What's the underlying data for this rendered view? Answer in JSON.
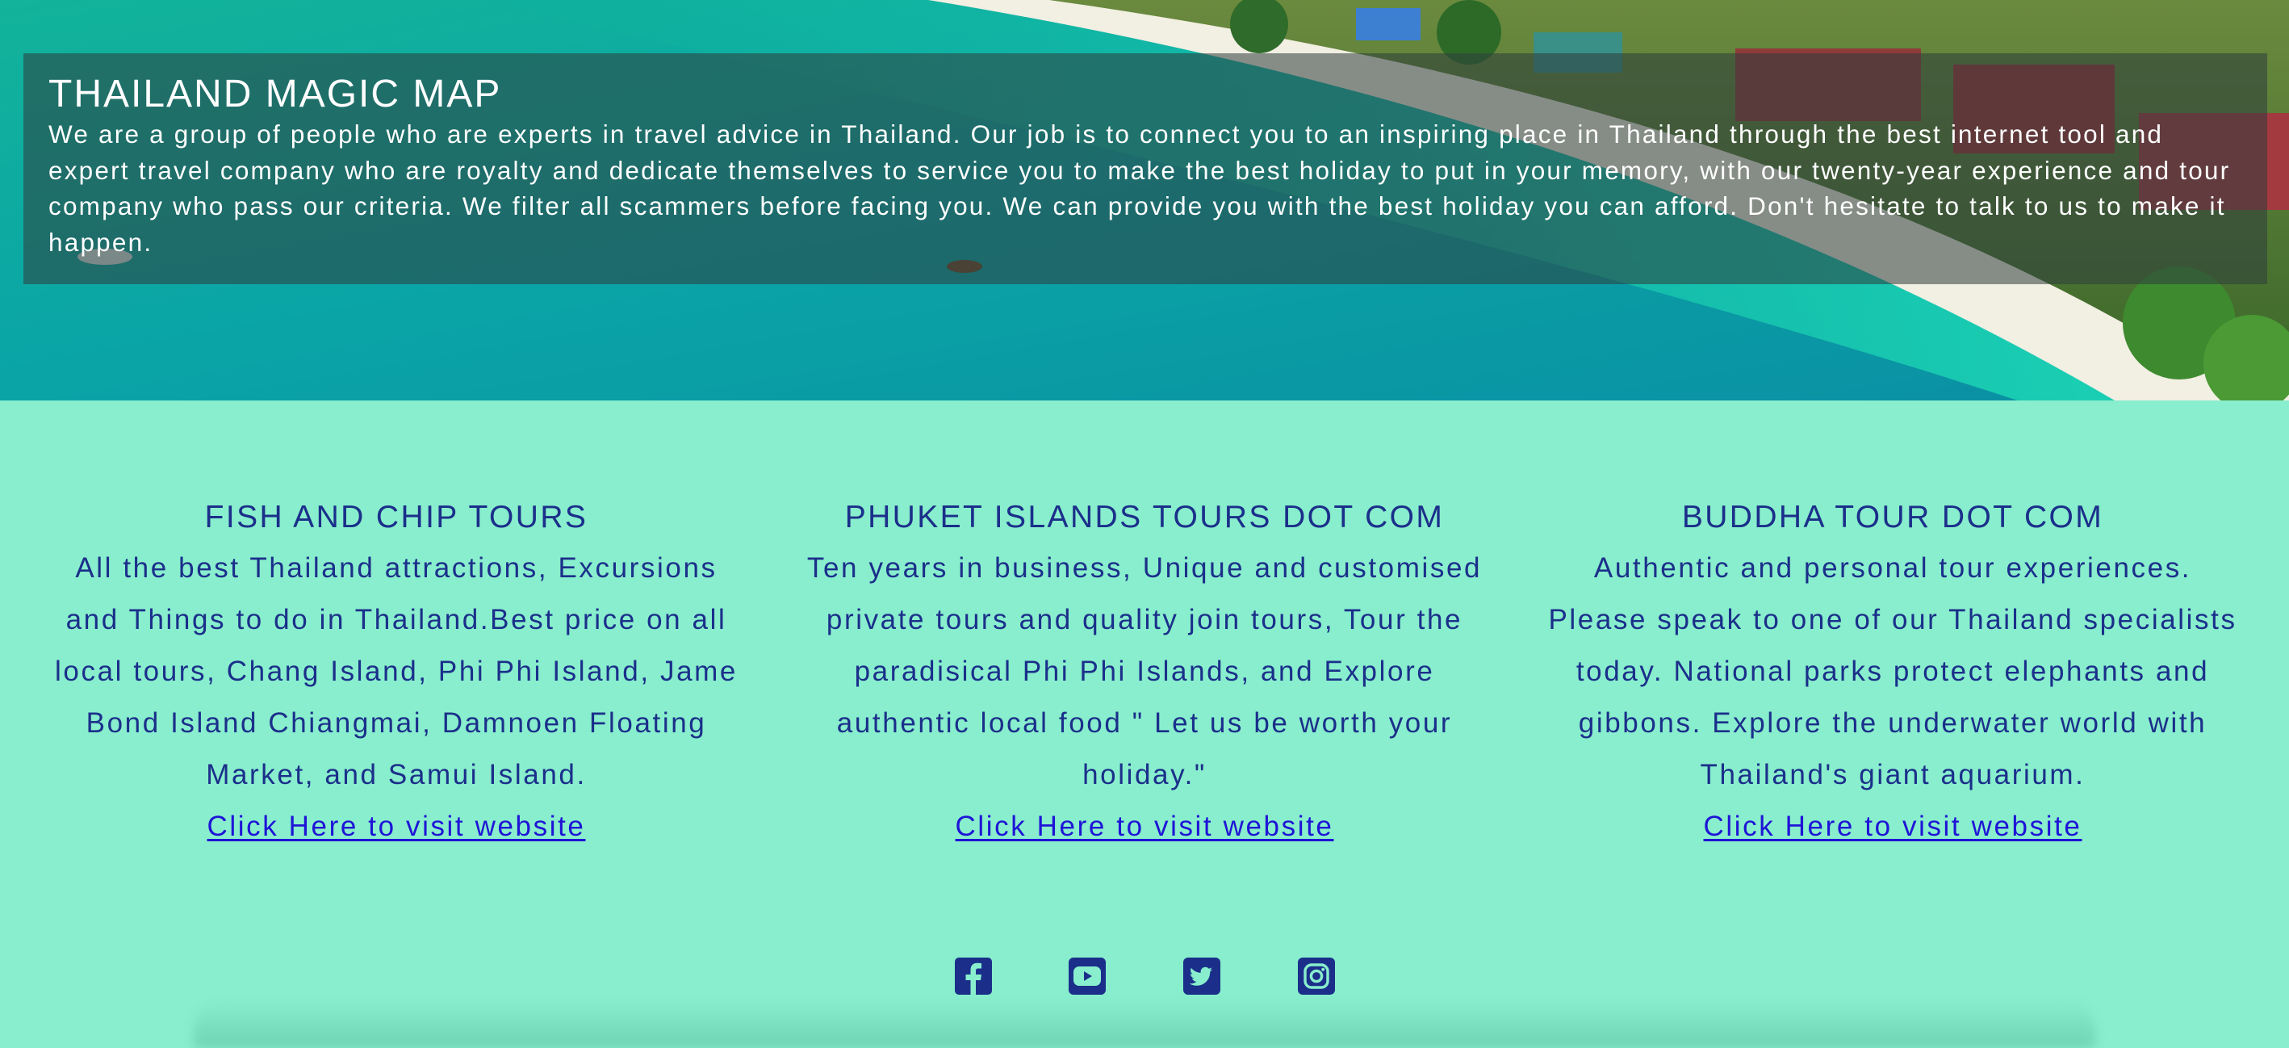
{
  "hero": {
    "title": "THAILAND MAGIC MAP",
    "text": "We are a group of people who are experts in travel advice in Thailand. Our job is to connect you to an inspiring place in Thailand through the best internet tool and expert travel company who are royalty and dedicate themselves to service you to make the best holiday to put in your memory, with our twenty-year experience and tour company who pass our criteria. We filter all scammers before facing you. We can provide you with the best holiday you can afford. Don't hesitate to talk to us to make it happen."
  },
  "tours": [
    {
      "title": "FISH AND CHIP TOURS",
      "text": "All the best Thailand attractions, Excursions and Things to do in Thailand.Best price on all local tours, Chang Island, Phi Phi Island, Jame Bond Island Chiangmai, Damnoen Floating Market, and Samui Island.",
      "link": "Click Here to visit website"
    },
    {
      "title": "PHUKET ISLANDS TOURS DOT COM",
      "text": "Ten years in business, Unique and customised private tours and quality join tours, Tour the paradisical Phi Phi Islands, and Explore authentic local food \" Let us be worth your holiday.\"",
      "link": "Click Here to visit website"
    },
    {
      "title": "BUDDHA TOUR DOT COM",
      "text": "Authentic and personal tour experiences. Please speak to one of our Thailand specialists today. National parks protect elephants and gibbons. Explore the underwater world with Thailand's giant aquarium.",
      "link": "Click Here to visit website"
    }
  ],
  "social": [
    "facebook-icon",
    "youtube-icon",
    "twitter-icon",
    "instagram-icon"
  ],
  "colors": {
    "background": "#88eecd",
    "heading": "#1b2f8a",
    "link": "#1f14d6",
    "icon": "#1b2f8a"
  }
}
